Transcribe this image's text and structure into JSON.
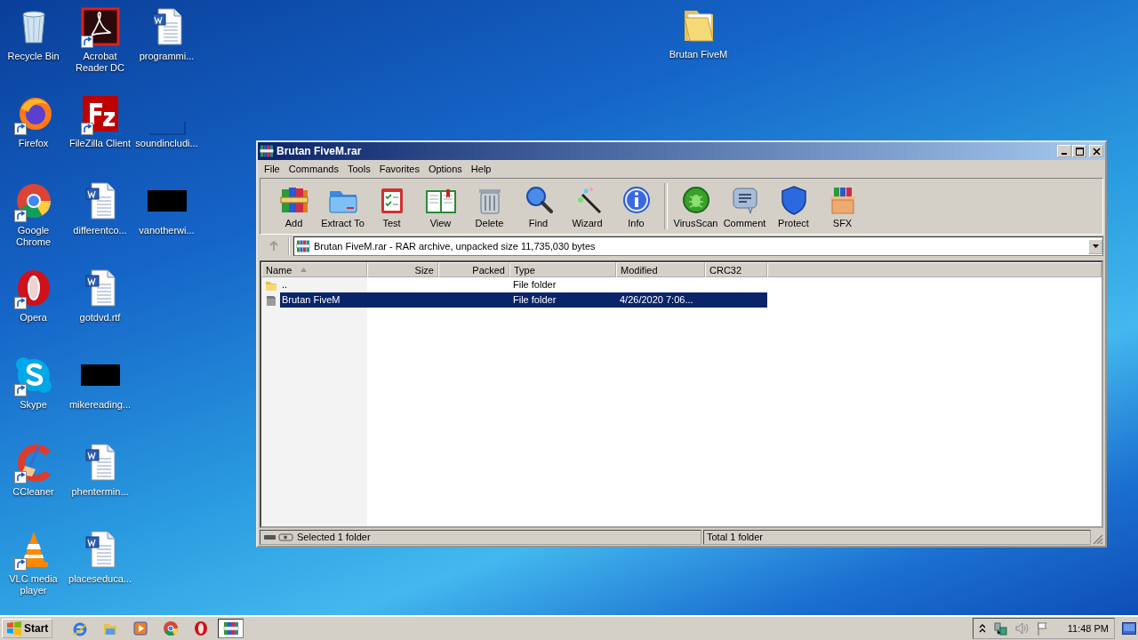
{
  "desktop": {
    "columns": [
      [
        {
          "label": "Recycle Bin",
          "kind": "recycle-bin",
          "shortcut": false
        },
        {
          "label": "Firefox",
          "kind": "firefox",
          "shortcut": true
        },
        {
          "label": "Google Chrome",
          "kind": "chrome",
          "shortcut": true
        },
        {
          "label": "Opera",
          "kind": "opera",
          "shortcut": true
        },
        {
          "label": "Skype",
          "kind": "skype",
          "shortcut": true
        },
        {
          "label": "CCleaner",
          "kind": "ccleaner",
          "shortcut": true
        },
        {
          "label": "VLC media player",
          "kind": "vlc",
          "shortcut": true
        }
      ],
      [
        {
          "label": "Acrobat Reader DC",
          "kind": "acrobat",
          "shortcut": true
        },
        {
          "label": "FileZilla Client",
          "kind": "filezilla",
          "shortcut": true
        },
        {
          "label": "differentco...",
          "kind": "word",
          "shortcut": false
        },
        {
          "label": "gotdvd.rtf",
          "kind": "word",
          "shortcut": false
        },
        {
          "label": "mikereading...",
          "kind": "thumbnail",
          "shortcut": false
        },
        {
          "label": "phentermin...",
          "kind": "word",
          "shortcut": false
        },
        {
          "label": "placeseduca...",
          "kind": "word",
          "shortcut": false
        }
      ],
      [
        {
          "label": "programmi...",
          "kind": "word",
          "shortcut": false
        },
        {
          "label": "soundincludi...",
          "kind": "blank",
          "shortcut": false
        },
        {
          "label": "vanotherwi...",
          "kind": "thumbnail",
          "shortcut": false
        }
      ]
    ],
    "folder": {
      "label": "Brutan FiveM",
      "kind": "folder",
      "shortcut": false
    }
  },
  "window": {
    "title": "Brutan FiveM.rar",
    "menu": [
      "File",
      "Commands",
      "Tools",
      "Favorites",
      "Options",
      "Help"
    ],
    "toolbar": [
      [
        {
          "label": "Add",
          "kind": "add"
        },
        {
          "label": "Extract To",
          "kind": "extract"
        },
        {
          "label": "Test",
          "kind": "test"
        },
        {
          "label": "View",
          "kind": "view"
        },
        {
          "label": "Delete",
          "kind": "delete"
        },
        {
          "label": "Find",
          "kind": "find"
        },
        {
          "label": "Wizard",
          "kind": "wizard"
        },
        {
          "label": "Info",
          "kind": "info"
        }
      ],
      [
        {
          "label": "VirusScan",
          "kind": "virusscan"
        },
        {
          "label": "Comment",
          "kind": "comment"
        },
        {
          "label": "Protect",
          "kind": "protect"
        },
        {
          "label": "SFX",
          "kind": "sfx"
        }
      ]
    ],
    "address": {
      "value": "Brutan FiveM.rar - RAR archive, unpacked size 11,735,030 bytes"
    },
    "list": {
      "columns": [
        {
          "label": "Name",
          "sorted": true
        },
        {
          "label": "Size",
          "sorted": false
        },
        {
          "label": "Packed",
          "sorted": false
        },
        {
          "label": "Type",
          "sorted": false
        },
        {
          "label": "Modified",
          "sorted": false
        },
        {
          "label": "CRC32",
          "sorted": false
        }
      ],
      "rows": [
        {
          "name": "..",
          "kind": "parent",
          "type": "File folder",
          "selected": false
        },
        {
          "name": "Brutan FiveM",
          "kind": "folder",
          "type": "File folder",
          "modified": "4/26/2020 7:06...",
          "selected": true
        }
      ]
    },
    "status_bar": {
      "left": "Selected 1 folder",
      "right": "Total 1 folder"
    }
  },
  "taskbar": {
    "start": "Start",
    "apps": [
      {
        "kind": "ie",
        "active": false
      },
      {
        "kind": "explorer",
        "active": false
      },
      {
        "kind": "media",
        "active": false
      },
      {
        "kind": "chrome",
        "active": false
      },
      {
        "kind": "opera",
        "active": false
      },
      {
        "kind": "winrar",
        "active": true
      }
    ],
    "clock": "11:48 PM"
  }
}
